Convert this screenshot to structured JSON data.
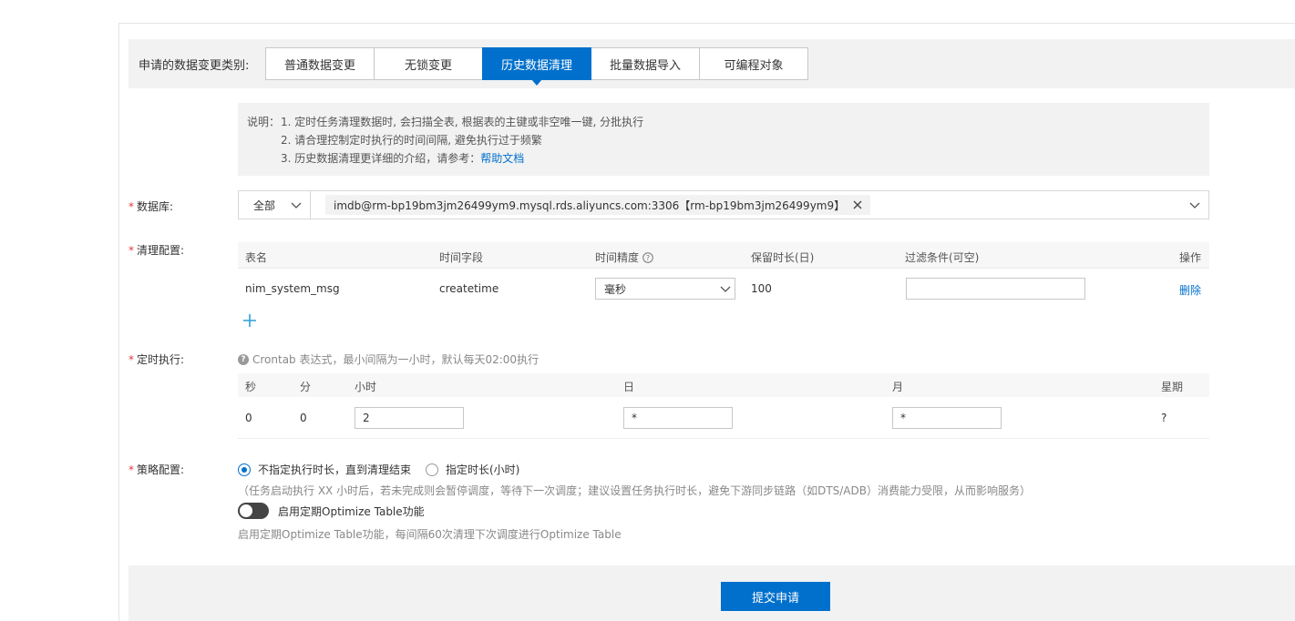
{
  "change_type": {
    "label": "申请的数据变更类别:",
    "tabs": [
      "普通数据变更",
      "无锁变更",
      "历史数据清理",
      "批量数据导入",
      "可编程对象"
    ],
    "active": "历史数据清理"
  },
  "note": {
    "prefix": "说明：",
    "line1": "1. 定时任务清理数据时, 会扫描全表, 根据表的主键或非空唯一键, 分批执行",
    "line2": "2. 请合理控制定时执行的时间间隔, 避免执行过于频繁",
    "line3": "3. 历史数据清理更详细的介绍，请参考：",
    "help_link": "帮助文档"
  },
  "database": {
    "label": "数据库:",
    "scope": "全部",
    "selected_tag": "imdb@rm-bp19bm3jm26499ym9.mysql.rds.aliyuncs.com:3306【rm-bp19bm3jm26499ym9】"
  },
  "cleanup": {
    "label": "清理配置:",
    "columns": {
      "table": "表名",
      "time_field": "时间字段",
      "precision": "时间精度",
      "retention": "保留时长(日)",
      "filter": "过滤条件(可空)",
      "op": "操作"
    },
    "row": {
      "table": "nim_system_msg",
      "time_field": "createtime",
      "precision": "毫秒",
      "retention": "100",
      "filter": "",
      "delete": "删除"
    }
  },
  "schedule": {
    "label": "定时执行:",
    "hint": "Crontab 表达式，最小间隔为一小时，默认每天02:00执行",
    "columns": {
      "sec": "秒",
      "min": "分",
      "hour": "小时",
      "day": "日",
      "month": "月",
      "week": "星期"
    },
    "values": {
      "sec": "0",
      "min": "0",
      "hour": "2",
      "day": "*",
      "month": "*",
      "week": "?"
    }
  },
  "strategy": {
    "label": "策略配置:",
    "option_unlimited": "不指定执行时长，直到清理结束",
    "option_limited": "指定时长(小时)",
    "selected": "不指定执行时长，直到清理结束",
    "note": "（任务启动执行 XX 小时后，若未完成则会暂停调度，等待下一次调度；建议设置任务执行时长，避免下游同步链路（如DTS/ADB）消费能力受限，从而影响服务）",
    "optimize_label": "启用定期Optimize Table功能",
    "optimize_enabled": false,
    "optimize_desc": "启用定期Optimize Table功能，每间隔60次清理下次调度进行Optimize Table"
  },
  "submit_label": "提交申请",
  "colors": {
    "accent": "#0070cc",
    "required": "#e4393c"
  },
  "icons": [
    "chevron-down-icon",
    "close-icon",
    "help-circle-icon",
    "plus-icon",
    "question-icon"
  ]
}
